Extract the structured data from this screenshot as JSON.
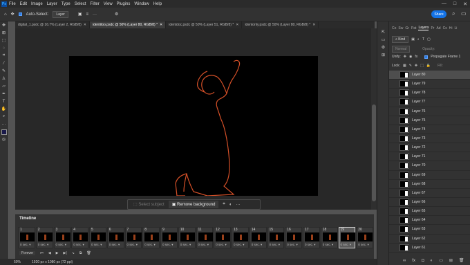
{
  "menu": [
    "File",
    "Edit",
    "Image",
    "Layer",
    "Type",
    "Select",
    "Filter",
    "View",
    "Plugins",
    "Window",
    "Help"
  ],
  "app_icon": "Ps",
  "window_controls": [
    "—",
    "□",
    "✕"
  ],
  "options": {
    "auto_select_label": "Auto-Select:",
    "auto_select_value": "Layer",
    "share_label": "Share"
  },
  "tabs": [
    {
      "label": "digital_1.psdc @ 16.7% (Layer 2, RGB/8)",
      "active": false
    },
    {
      "label": "identitoo.psdc @ 50% (Layer 80, RGB/8) *",
      "active": true
    },
    {
      "label": "identdoc.psdc @ 50% (Layer 51, RGB/8) *",
      "active": false
    },
    {
      "label": "identonly.psdc @ 50% (Layer 80, RGB/8) *",
      "active": false
    }
  ],
  "tools": [
    "move-icon",
    "artboard-icon",
    "marquee-icon",
    "lasso-icon",
    "crop-icon",
    "eyedropper-icon",
    "brush-icon",
    "stamp-icon",
    "eraser-icon",
    "pen-icon",
    "type-icon",
    "hand-icon",
    "zoom-icon",
    "more-icon",
    "color-swatch",
    "quickmask-icon"
  ],
  "context_bar": {
    "select_subject": "Select subject",
    "remove_background": "Remove background"
  },
  "timeline": {
    "title": "Timeline",
    "loop": "Forever",
    "frames": [
      {
        "n": "1",
        "delay": "0 sec.",
        "selected": false
      },
      {
        "n": "2",
        "delay": "0 sec.",
        "selected": false
      },
      {
        "n": "3",
        "delay": "0 sec.",
        "selected": false
      },
      {
        "n": "4",
        "delay": "0 sec.",
        "selected": false
      },
      {
        "n": "5",
        "delay": "0 sec.",
        "selected": false
      },
      {
        "n": "6",
        "delay": "0 sec.",
        "selected": false
      },
      {
        "n": "7",
        "delay": "0 sec.",
        "selected": false
      },
      {
        "n": "8",
        "delay": "0 sec.",
        "selected": false
      },
      {
        "n": "9",
        "delay": "0 sec.",
        "selected": false
      },
      {
        "n": "10",
        "delay": "0 sec.",
        "selected": false
      },
      {
        "n": "11",
        "delay": "0 sec.",
        "selected": false
      },
      {
        "n": "12",
        "delay": "0 sec.",
        "selected": false
      },
      {
        "n": "13",
        "delay": "0 sec.",
        "selected": false
      },
      {
        "n": "14",
        "delay": "0 sec.",
        "selected": false
      },
      {
        "n": "15",
        "delay": "0 sec.",
        "selected": false
      },
      {
        "n": "16",
        "delay": "0 sec.",
        "selected": false
      },
      {
        "n": "17",
        "delay": "0 sec.",
        "selected": false
      },
      {
        "n": "18",
        "delay": "0 sec.",
        "selected": false
      },
      {
        "n": "19",
        "delay": "0 sec.",
        "selected": true
      },
      {
        "n": "20",
        "delay": "0 sec.",
        "selected": false
      }
    ]
  },
  "status": {
    "zoom": "50%",
    "doc_size": "1920 px x 1080 px (72 ppi)"
  },
  "panels": {
    "tabs": [
      "Co",
      "Sw",
      "Gr",
      "Pat",
      "Layers",
      "Pr",
      "Ad",
      "Cs",
      "Hi",
      "Li"
    ],
    "active_tab": "Layers",
    "filter_kind": "Kind",
    "blend_mode": "Normal",
    "opacity_label": "Opacity:",
    "unify_label": "Unify:",
    "propagate_label": "Propagate Frame 1",
    "lock_label": "Lock:",
    "fill_label": "Fill:",
    "layers": [
      "Layer 80",
      "Layer 79",
      "Layer 78",
      "Layer 77",
      "Layer 76",
      "Layer 75",
      "Layer 74",
      "Layer 73",
      "Layer 72",
      "Layer 71",
      "Layer 70",
      "Layer 69",
      "Layer 68",
      "Layer 67",
      "Layer 66",
      "Layer 65",
      "Layer 64",
      "Layer 63",
      "Layer 62",
      "Layer 61"
    ],
    "selected_layer": "Layer 80"
  },
  "colors": {
    "accent": "#1473e6",
    "outline": "#e0542a"
  }
}
